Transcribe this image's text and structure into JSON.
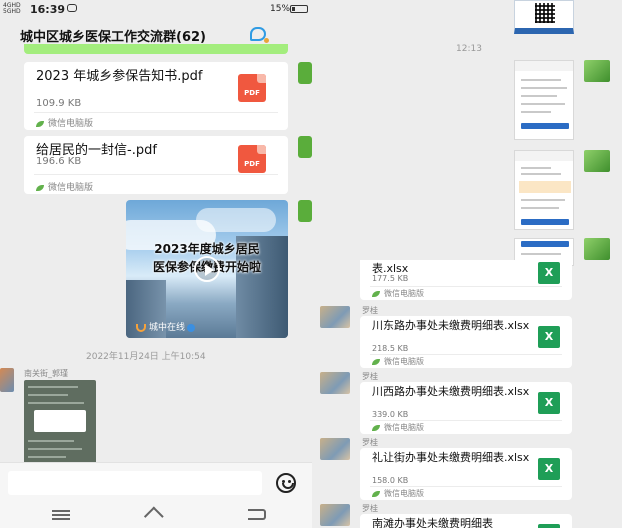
{
  "status_bar": {
    "signal_text": "4GHD\n5GHD",
    "time": "16:39",
    "battery_percent": "15%"
  },
  "chat": {
    "title": "城中区城乡医保工作交流群(62)"
  },
  "left_messages": {
    "file1": {
      "name": "2023 年城乡参保告知书.pdf",
      "size": "109.9 KB",
      "source": "微信电脑版",
      "icon_label": "PDF"
    },
    "file2": {
      "name": "给居民的一封信-.pdf",
      "size": "196.6 KB",
      "source": "微信电脑版",
      "icon_label": "PDF"
    },
    "video": {
      "line1": "2023年度城乡居民",
      "line2": "医保参保缴费开始啦",
      "brand": "城中在线"
    },
    "timestamp": "2022年11月24日 上午10:54",
    "sender": "南关街_郭瑾"
  },
  "right_messages": {
    "timestamp": "12:13",
    "partial_file": {
      "name": "表.xlsx",
      "size": "177.5 KB",
      "source": "微信电脑版",
      "icon_label": "X"
    },
    "files": [
      {
        "sender": "罗桂",
        "name": "川东路办事处未缴费明细表.xlsx",
        "size": "218.5 KB",
        "source": "微信电脑版",
        "icon_label": "X"
      },
      {
        "sender": "罗桂",
        "name": "川西路办事处未缴费明细表.xlsx",
        "size": "339.0 KB",
        "source": "微信电脑版",
        "icon_label": "X"
      },
      {
        "sender": "罗桂",
        "name": "礼让街办事处未缴费明细表.xlsx",
        "size": "158.0 KB",
        "source": "微信电脑版",
        "icon_label": "X"
      },
      {
        "sender": "罗桂",
        "name": "南滩办事处未缴费明细表",
        "icon_label": "X"
      }
    ]
  },
  "colors": {
    "bubble_green": "#95ec69",
    "pdf_red": "#f0583f",
    "excel_green": "#1f9e57",
    "chat_bg": "#ededed"
  },
  "icons": {
    "title_icon": "chat-bubble-icon",
    "emoji": "emoji-icon",
    "nav": [
      "menu-icon",
      "home-icon",
      "back-icon"
    ]
  }
}
